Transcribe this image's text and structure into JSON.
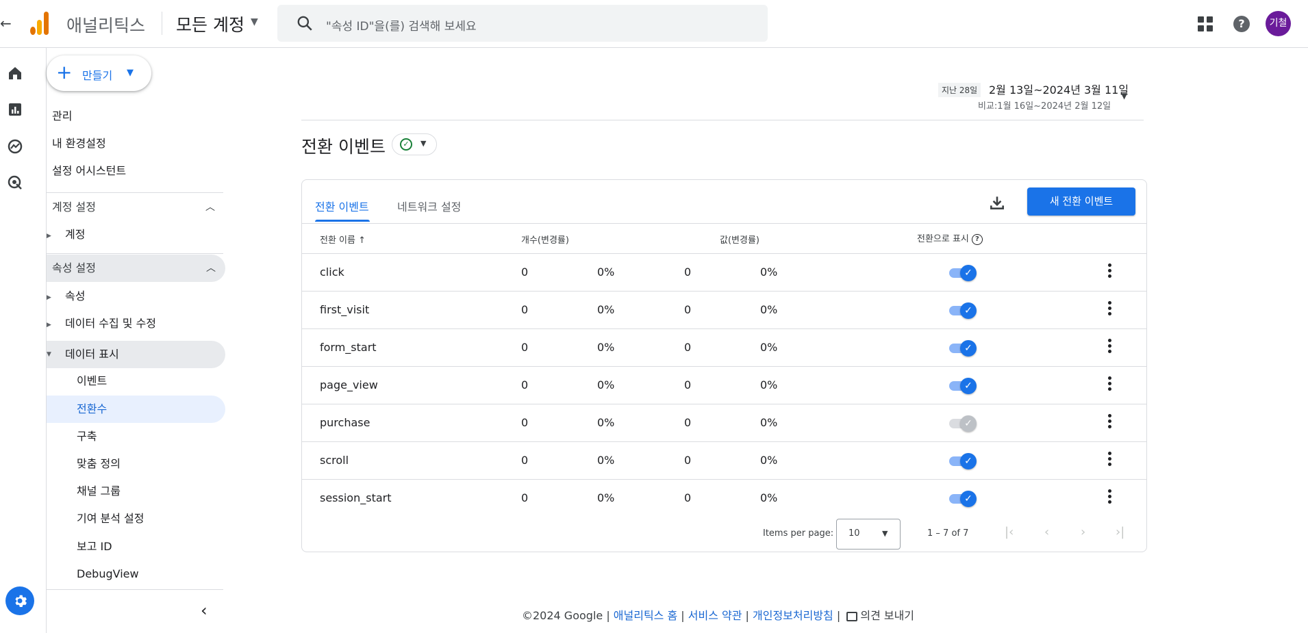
{
  "header": {
    "app_name": "애널리틱스",
    "account": "모든 계정",
    "search_placeholder": "\"속성 ID\"을(를) 검색해 보세요",
    "avatar_initials": "기철",
    "brand_colors": {
      "bar1": "#f9ab00",
      "bar2": "#e37400",
      "bar3": "#e37400"
    }
  },
  "rail": {
    "items": [
      "home-icon",
      "reports-icon",
      "explore-icon",
      "advertising-icon"
    ],
    "settings": "gear-icon"
  },
  "sidebar": {
    "create_label": "만들기",
    "top_items": [
      "관리",
      "내 환경설정",
      "설정 어시스턴트"
    ],
    "account_section": "계정 설정",
    "account_items": [
      "계정"
    ],
    "property_section": "속성 설정",
    "property_items": [
      "속성",
      "데이터 수집 및 수정",
      "데이터 표시"
    ],
    "display_items": [
      "이벤트",
      "전환수",
      "구축",
      "맞춤 정의",
      "채널 그룹",
      "기여 분석 설정",
      "보고 ID",
      "DebugView"
    ]
  },
  "date": {
    "chip": "지난 28일",
    "range": "2월 13일~2024년 3월 11일",
    "compare": "비교:1월 16일~2024년 2월 12일"
  },
  "page": {
    "title": "전환 이벤트"
  },
  "tabs": [
    "전환 이벤트",
    "네트워크 설정"
  ],
  "actions": {
    "new_button": "새 전환 이벤트"
  },
  "table": {
    "headers": {
      "name": "전환 이름",
      "count": "개수(변경률)",
      "value": "값(변경률)",
      "mark": "전환으로 표시"
    },
    "rows": [
      {
        "name": "click",
        "count": "0",
        "count_change": "0%",
        "value": "0",
        "value_change": "0%",
        "enabled": true
      },
      {
        "name": "first_visit",
        "count": "0",
        "count_change": "0%",
        "value": "0",
        "value_change": "0%",
        "enabled": true
      },
      {
        "name": "form_start",
        "count": "0",
        "count_change": "0%",
        "value": "0",
        "value_change": "0%",
        "enabled": true
      },
      {
        "name": "page_view",
        "count": "0",
        "count_change": "0%",
        "value": "0",
        "value_change": "0%",
        "enabled": true
      },
      {
        "name": "purchase",
        "count": "0",
        "count_change": "0%",
        "value": "0",
        "value_change": "0%",
        "enabled": false
      },
      {
        "name": "scroll",
        "count": "0",
        "count_change": "0%",
        "value": "0",
        "value_change": "0%",
        "enabled": true
      },
      {
        "name": "session_start",
        "count": "0",
        "count_change": "0%",
        "value": "0",
        "value_change": "0%",
        "enabled": true
      }
    ]
  },
  "pager": {
    "label": "Items per page:",
    "size": "10",
    "range": "1 – 7 of 7"
  },
  "footer": {
    "copyright": "©2024 Google | ",
    "link1": "애널리틱스 홈",
    "sep1": " | ",
    "link2": "서비스 약관",
    "sep2": " | ",
    "link3": "개인정보처리방침",
    "sep3": " | ",
    "feedback": "의견 보내기"
  }
}
